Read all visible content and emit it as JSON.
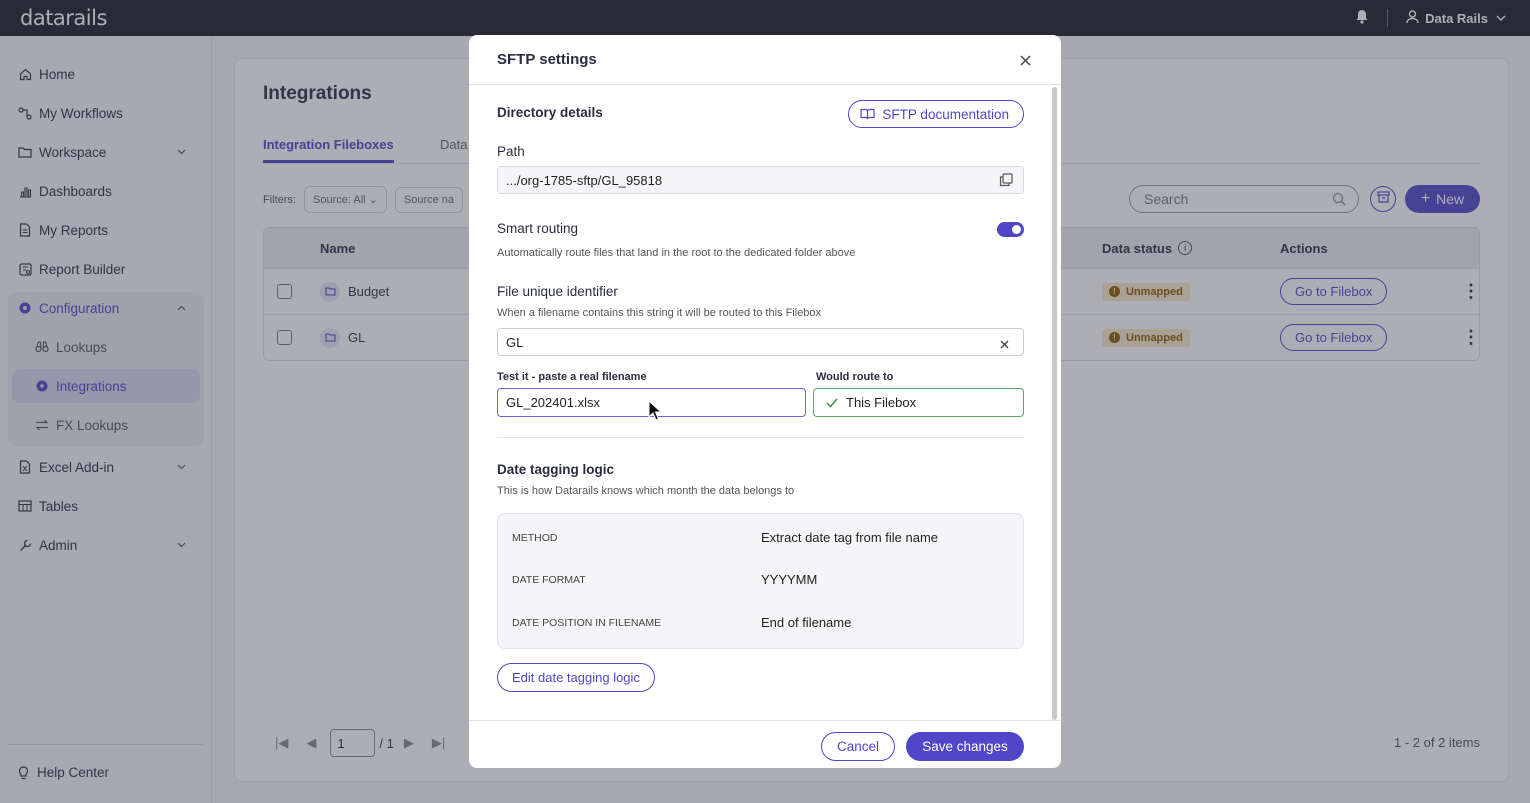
{
  "app": {
    "logo": "datarails",
    "user_name": "Data Rails"
  },
  "sidebar": {
    "items": [
      {
        "label": "Home"
      },
      {
        "label": "My Workflows"
      },
      {
        "label": "Workspace"
      },
      {
        "label": "Dashboards"
      },
      {
        "label": "My Reports"
      },
      {
        "label": "Report Builder"
      },
      {
        "label": "Configuration"
      },
      {
        "label": "Lookups"
      },
      {
        "label": "Integrations"
      },
      {
        "label": "FX Lookups"
      },
      {
        "label": "Excel Add-in"
      },
      {
        "label": "Tables"
      },
      {
        "label": "Admin"
      }
    ],
    "help": "Help Center"
  },
  "page": {
    "title": "Integrations",
    "tabs": [
      "Integration Fileboxes",
      "Data"
    ],
    "filters_label": "Filters:",
    "filter_source": "Source: All",
    "filter_source_name": "Source na",
    "search_placeholder": "Search",
    "new_label": "New",
    "columns": {
      "name": "Name",
      "data_status": "Data status",
      "actions": "Actions"
    },
    "rows": [
      {
        "name": "Budget",
        "status": "Unmapped",
        "action": "Go to Filebox"
      },
      {
        "name": "GL",
        "status": "Unmapped",
        "action": "Go to Filebox"
      }
    ],
    "pager": {
      "page": "1",
      "of": "/ 1"
    },
    "items_count": "1 - 2 of 2 items"
  },
  "modal": {
    "title": "SFTP settings",
    "directory_title": "Directory details",
    "doc_button": "SFTP documentation",
    "path_label": "Path",
    "path_value": ".../org-1785-sftp/GL_95818",
    "smart_routing_label": "Smart routing",
    "smart_routing_hint": "Automatically route files that land in the root to the dedicated folder above",
    "smart_routing_on": true,
    "identifier_label": "File unique identifier",
    "identifier_hint": "When a filename contains this string it will be routed to this Filebox",
    "identifier_value": "GL",
    "test_label": "Test it - paste a real filename",
    "test_value": "GL_202401.xlsx",
    "route_label": "Would route to",
    "route_value": "This Filebox",
    "date_title": "Date tagging logic",
    "date_hint": "This is how Datarails knows which month the data belongs to",
    "method": [
      {
        "key": "METHOD",
        "value": "Extract date tag from file name"
      },
      {
        "key": "DATE FORMAT",
        "value": "YYYYMM"
      },
      {
        "key": "DATE POSITION IN FILENAME",
        "value": "End of filename"
      }
    ],
    "edit_button": "Edit date tagging logic",
    "cancel": "Cancel",
    "save": "Save changes"
  },
  "colors": {
    "accent": "#4f46c8",
    "topbar": "#1c1d29",
    "badge_bg": "#fbe7c6",
    "success": "#5aa86a"
  }
}
